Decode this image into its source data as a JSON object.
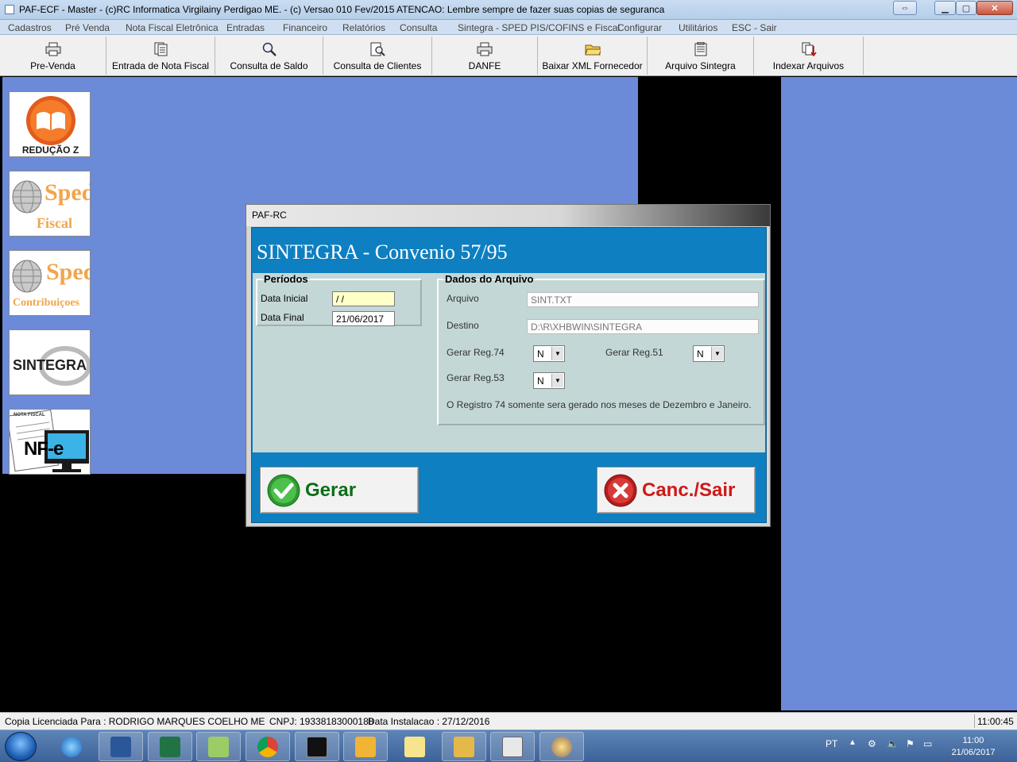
{
  "window": {
    "title": "PAF-ECF - Master - (c)RC Informatica Virgilainy Perdigao ME.  - (c) Versao 010 Fev/2015 ATENCAO: Lembre sempre de fazer suas copias de seguranca"
  },
  "menu": [
    "Cadastros",
    "Pré Venda",
    "Nota Fiscal Eletrônica",
    "Entradas",
    "Financeiro",
    "Relatórios",
    "Consulta",
    "Sintegra - SPED PIS/COFINS e Fiscal",
    "Configurar",
    "Utilitários",
    "ESC - Sair"
  ],
  "toolbar": [
    {
      "label": "Pre-Venda",
      "icon": "printer-icon"
    },
    {
      "label": "Entrada de Nota Fiscal",
      "icon": "documents-icon"
    },
    {
      "label": "Consulta de Saldo",
      "icon": "magnifier-icon"
    },
    {
      "label": "Consulta de Clientes",
      "icon": "document-search-icon"
    },
    {
      "label": "DANFE",
      "icon": "printer-icon"
    },
    {
      "label": "Baixar XML Fornecedor",
      "icon": "folder-open-icon"
    },
    {
      "label": "Arquivo Sintegra",
      "icon": "notepad-icon"
    },
    {
      "label": "Indexar Arquivos",
      "icon": "index-files-icon"
    }
  ],
  "side_tiles": {
    "reducao_z": "REDUÇÃO Z",
    "sped_fiscal_top": "Sped",
    "sped_fiscal_bottom": "Fiscal",
    "sped_contrib_top": "Sped",
    "sped_contrib_bottom": "Contribuiçoes",
    "sintegra": "SINTEGRA",
    "nfe_small": "NOTA FISCAL",
    "nfe_big": "NF-e"
  },
  "dialog": {
    "title": "PAF-RC",
    "header": "SINTEGRA - Convenio 57/95",
    "periodos": {
      "legend": "Períodos",
      "data_inicial_label": "Data Inicial",
      "data_inicial_value": " / /",
      "data_final_label": "Data Final",
      "data_final_value": "21/06/2017"
    },
    "dados": {
      "legend": "Dados do Arquivo",
      "arquivo_label": "Arquivo",
      "arquivo_value": "SINT.TXT",
      "destino_label": "Destino",
      "destino_value": "D:\\R\\XHBWIN\\SINTEGRA",
      "reg74_label": "Gerar Reg.74",
      "reg74_value": "N",
      "reg51_label": "Gerar Reg.51",
      "reg51_value": "N",
      "reg53_label": "Gerar Reg.53",
      "reg53_value": "N",
      "note": "O Registro 74 somente sera gerado nos meses de Dezembro e Janeiro."
    },
    "gerar_label": "Gerar",
    "cancel_label": "Canc./Sair"
  },
  "statusbar": {
    "license": "Copia Licenciada Para : RODRIGO MARQUES COELHO ME",
    "cnpj": "CNPJ: 19338183000188",
    "install": "Data Instalacao : 27/12/2016",
    "time": "11:00:45"
  },
  "taskbar": {
    "lang": "PT",
    "clock_time": "11:00",
    "clock_date": "21/06/2017"
  },
  "colors": {
    "desktop_blue": "#6b8ad8",
    "dialog_header_blue": "#0e7fc1",
    "form_bg": "#c4d7d7",
    "gerar_green": "#0a6e18",
    "cancel_red": "#d01818"
  }
}
